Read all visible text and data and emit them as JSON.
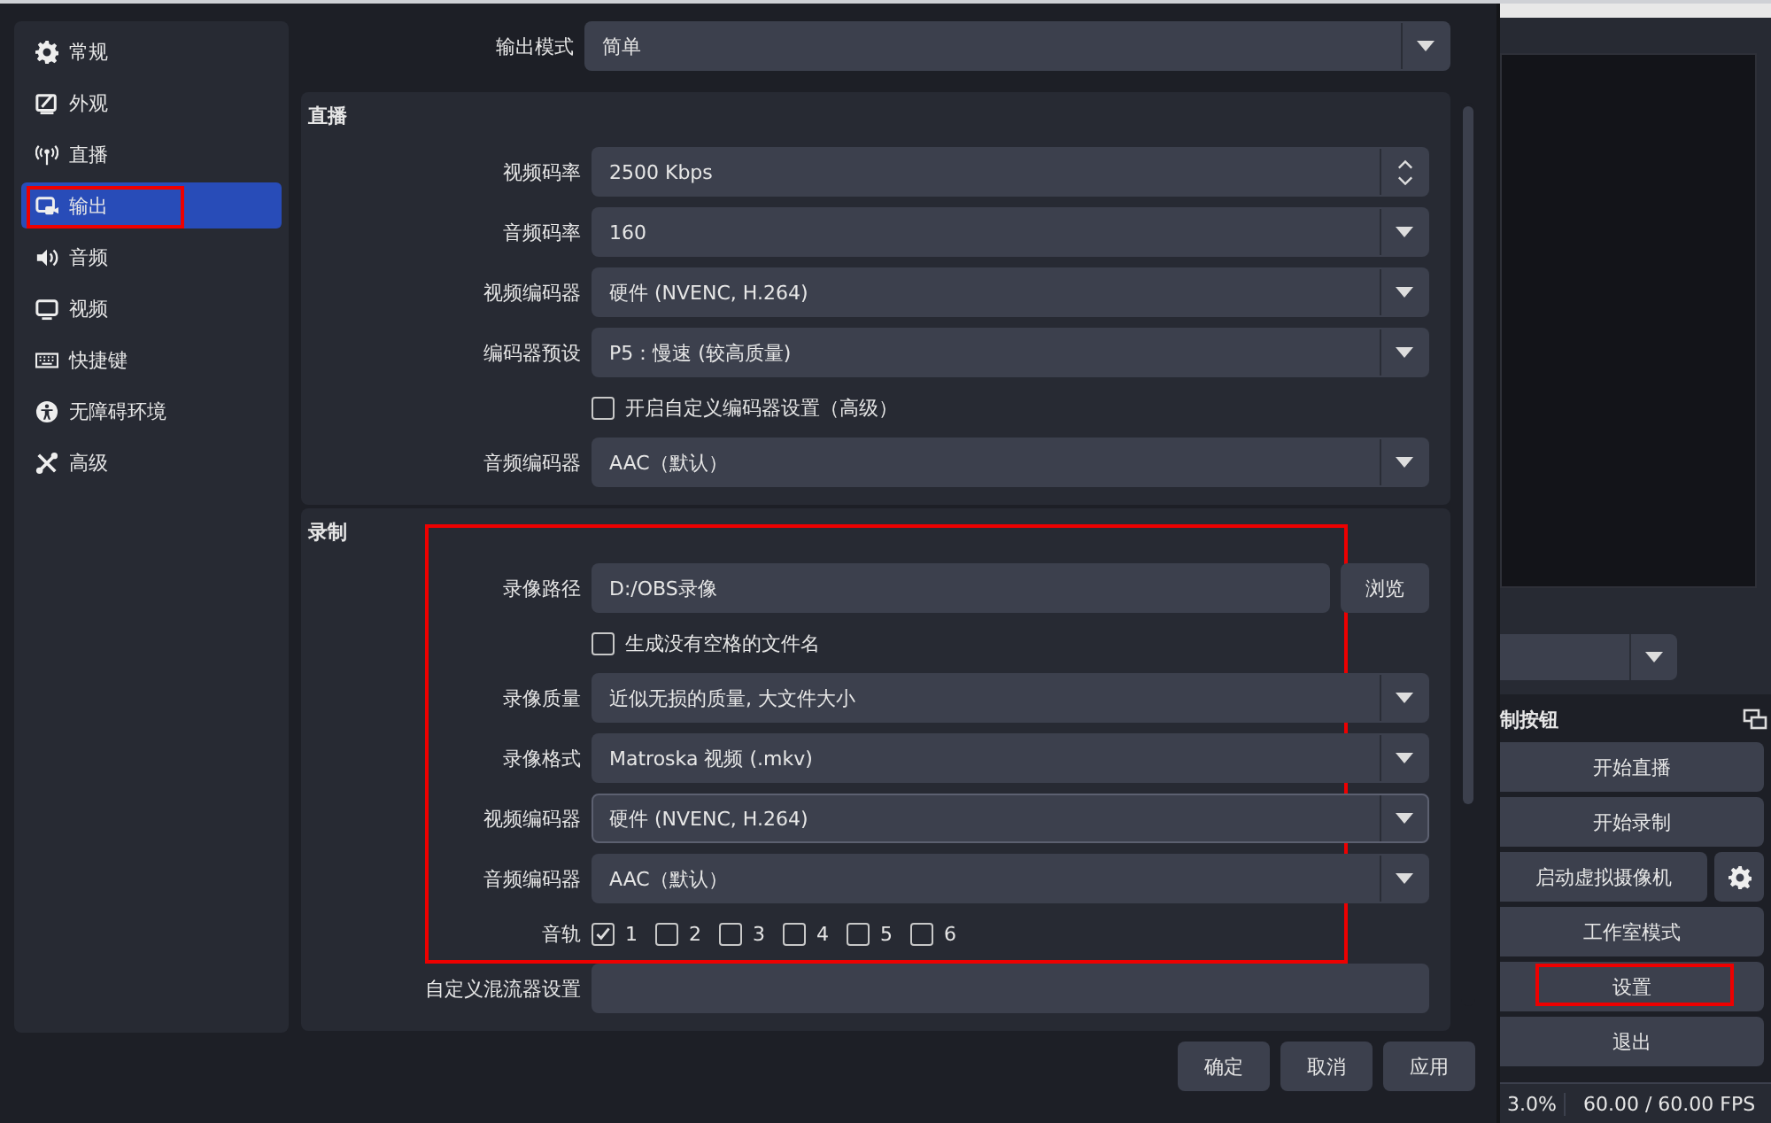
{
  "sidebar": {
    "items": [
      {
        "label": "常规",
        "selected": false,
        "highlighted": false
      },
      {
        "label": "外观",
        "selected": false,
        "highlighted": false
      },
      {
        "label": "直播",
        "selected": false,
        "highlighted": false
      },
      {
        "label": "输出",
        "selected": true,
        "highlighted": true
      },
      {
        "label": "音频",
        "selected": false,
        "highlighted": false
      },
      {
        "label": "视频",
        "selected": false,
        "highlighted": false
      },
      {
        "label": "快捷键",
        "selected": false,
        "highlighted": false
      },
      {
        "label": "无障碍环境",
        "selected": false,
        "highlighted": false
      },
      {
        "label": "高级",
        "selected": false,
        "highlighted": false
      }
    ]
  },
  "output_mode": {
    "label": "输出模式",
    "value": "简单"
  },
  "sections": [
    {
      "title": "直播",
      "groups": [
        {
          "highlighted": false,
          "rows": [
            {
              "kind": "spin",
              "label": "视频码率",
              "value": "2500 Kbps"
            },
            {
              "kind": "select",
              "label": "音频码率",
              "value": "160"
            },
            {
              "kind": "select",
              "label": "视频编码器",
              "value": "硬件 (NVENC, H.264)"
            },
            {
              "kind": "select",
              "label": "编码器预设",
              "value": "P5：慢速 (较高质量)"
            },
            {
              "kind": "checkbox",
              "text": "开启自定义编码器设置（高级）",
              "checked": false
            },
            {
              "kind": "select",
              "label": "音频编码器",
              "value": "AAC（默认）"
            }
          ]
        }
      ]
    },
    {
      "title": "录制",
      "groups": [
        {
          "highlighted": true,
          "rows": [
            {
              "kind": "path",
              "label": "录像路径",
              "value": "D:/OBS录像",
              "button": "浏览"
            },
            {
              "kind": "checkbox",
              "text": "生成没有空格的文件名",
              "checked": false
            },
            {
              "kind": "select",
              "label": "录像质量",
              "value": "近似无损的质量, 大文件大小"
            },
            {
              "kind": "select",
              "label": "录像格式",
              "value": "Matroska 视频 (.mkv)"
            },
            {
              "kind": "select",
              "label": "视频编码器",
              "value": "硬件 (NVENC, H.264)",
              "focused": true
            },
            {
              "kind": "select",
              "label": "音频编码器",
              "value": "AAC（默认）"
            },
            {
              "kind": "tracks",
              "label": "音轨",
              "tracks": [
                {
                  "label": "1",
                  "checked": true
                },
                {
                  "label": "2",
                  "checked": false
                },
                {
                  "label": "3",
                  "checked": false
                },
                {
                  "label": "4",
                  "checked": false
                },
                {
                  "label": "5",
                  "checked": false
                },
                {
                  "label": "6",
                  "checked": false
                }
              ]
            }
          ]
        },
        {
          "highlighted": false,
          "rows": [
            {
              "kind": "text",
              "label": "自定义混流器设置"
            }
          ]
        }
      ]
    }
  ],
  "dialog_buttons": [
    "确定",
    "取消",
    "应用"
  ],
  "controls": {
    "title": "制按钮",
    "buttons": [
      {
        "label": "开始直播",
        "highlighted": false,
        "gear": false
      },
      {
        "label": "开始录制",
        "highlighted": false,
        "gear": false
      },
      {
        "label": "启动虚拟摄像机",
        "highlighted": false,
        "gear": true
      },
      {
        "label": "工作室模式",
        "highlighted": false,
        "gear": false
      },
      {
        "label": "设置",
        "highlighted": true,
        "gear": false
      },
      {
        "label": "退出",
        "highlighted": false,
        "gear": false
      }
    ]
  },
  "status_bar": {
    "cpu": "3.0%",
    "fps": "60.00 / 60.00 FPS"
  }
}
